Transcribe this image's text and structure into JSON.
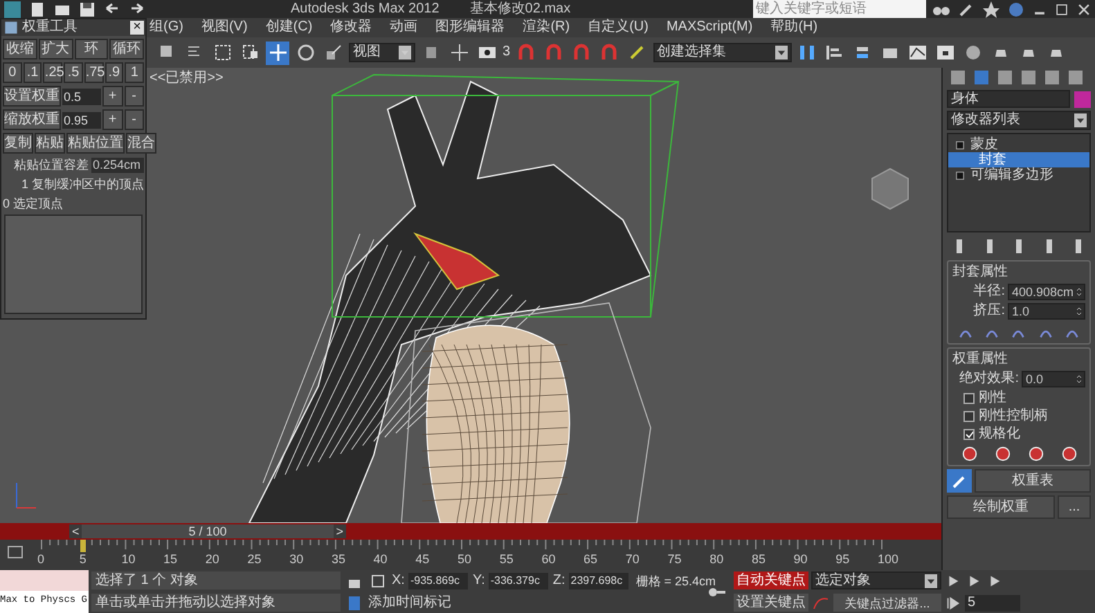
{
  "title_bar": {
    "app_title": "Autodesk 3ds Max  2012",
    "file_name": "基本修改02.max",
    "search": {
      "placeholder": "键入关键字或短语"
    }
  },
  "menu_bar": [
    "组(G)",
    "视图(V)",
    "创建(C)",
    "修改器",
    "动画",
    "图形编辑器",
    "渲染(R)",
    "自定义(U)",
    "MAXScript(M)",
    "帮助(H)"
  ],
  "main_toolbar": {
    "view_dropdown": "视图",
    "selection_set_dropdown": "创建选择集",
    "snap_label": "3"
  },
  "viewport": {
    "label": "<<已禁用>>"
  },
  "weight_tool": {
    "title": "权重工具",
    "close": "×",
    "buttons": [
      "收缩",
      "扩大",
      "环",
      "循环"
    ],
    "presets": [
      "0",
      ".1",
      ".25",
      ".5",
      ".75",
      ".9",
      "1"
    ],
    "set_weight": {
      "label": "设置权重",
      "value": "0.5",
      "plus": "+",
      "minus": "-"
    },
    "scale_weight": {
      "label": "缩放权重",
      "value": "0.95",
      "plus": "+",
      "minus": "-"
    },
    "copy_buttons": [
      "复制",
      "粘贴",
      "粘贴位置",
      "混合"
    ],
    "tolerance": {
      "label": "粘贴位置容差",
      "value": "0.254cm"
    },
    "buffer_info": "1 复制缓冲区中的顶点",
    "selected_info": "0 选定顶点"
  },
  "command_panel": {
    "object_name": "身体",
    "modifier_list": "修改器列表",
    "stack": [
      {
        "label": "蒙皮",
        "selected": false,
        "children": [
          {
            "label": "封套",
            "selected": true
          }
        ]
      },
      {
        "label": "可编辑多边形",
        "selected": false
      }
    ],
    "envelope": {
      "title": "封套属性",
      "radius": {
        "label": "半径:",
        "value": "400.908cm"
      },
      "squash": {
        "label": "挤压:",
        "value": "1.0"
      }
    },
    "weight": {
      "title": "权重属性",
      "absolute": {
        "label": "绝对效果:",
        "value": "0.0"
      },
      "checkboxes": [
        {
          "label": "刚性",
          "checked": false
        },
        {
          "label": "刚性控制柄",
          "checked": false
        },
        {
          "label": "规格化",
          "checked": true
        }
      ]
    },
    "weight_table_button": "权重表",
    "paint_weights_button": "绘制权重",
    "more_button": "..."
  },
  "time_slider": {
    "frame": "5 / 100",
    "prev": "<",
    "next": ">",
    "level": 0.05
  },
  "track_bar": {
    "ticks": [
      "0",
      "5",
      "10",
      "15",
      "20",
      "25",
      "30",
      "35",
      "40",
      "45",
      "50",
      "55",
      "60",
      "65",
      "70",
      "75",
      "80",
      "85",
      "90",
      "95",
      "100"
    ]
  },
  "status_bar": {
    "script_listener": "Max to Physcs G",
    "selection_status": "选择了 1 个 对象",
    "prompt": "单击或单击并拖动以选择对象",
    "x": {
      "label": "X:",
      "value": "-935.869c"
    },
    "y": {
      "label": "Y:",
      "value": "-336.379c"
    },
    "z": {
      "label": "Z:",
      "value": "2397.698c"
    },
    "grid": "栅格 = 25.4cm",
    "add_time_tag": "添加时间标记",
    "auto_key": {
      "label": "自动关键点",
      "on": true
    },
    "key_mode_dropdown": "选定对象",
    "set_key": "设置关键点",
    "key_filters": "关键点过滤器...",
    "current_frame": "5"
  }
}
